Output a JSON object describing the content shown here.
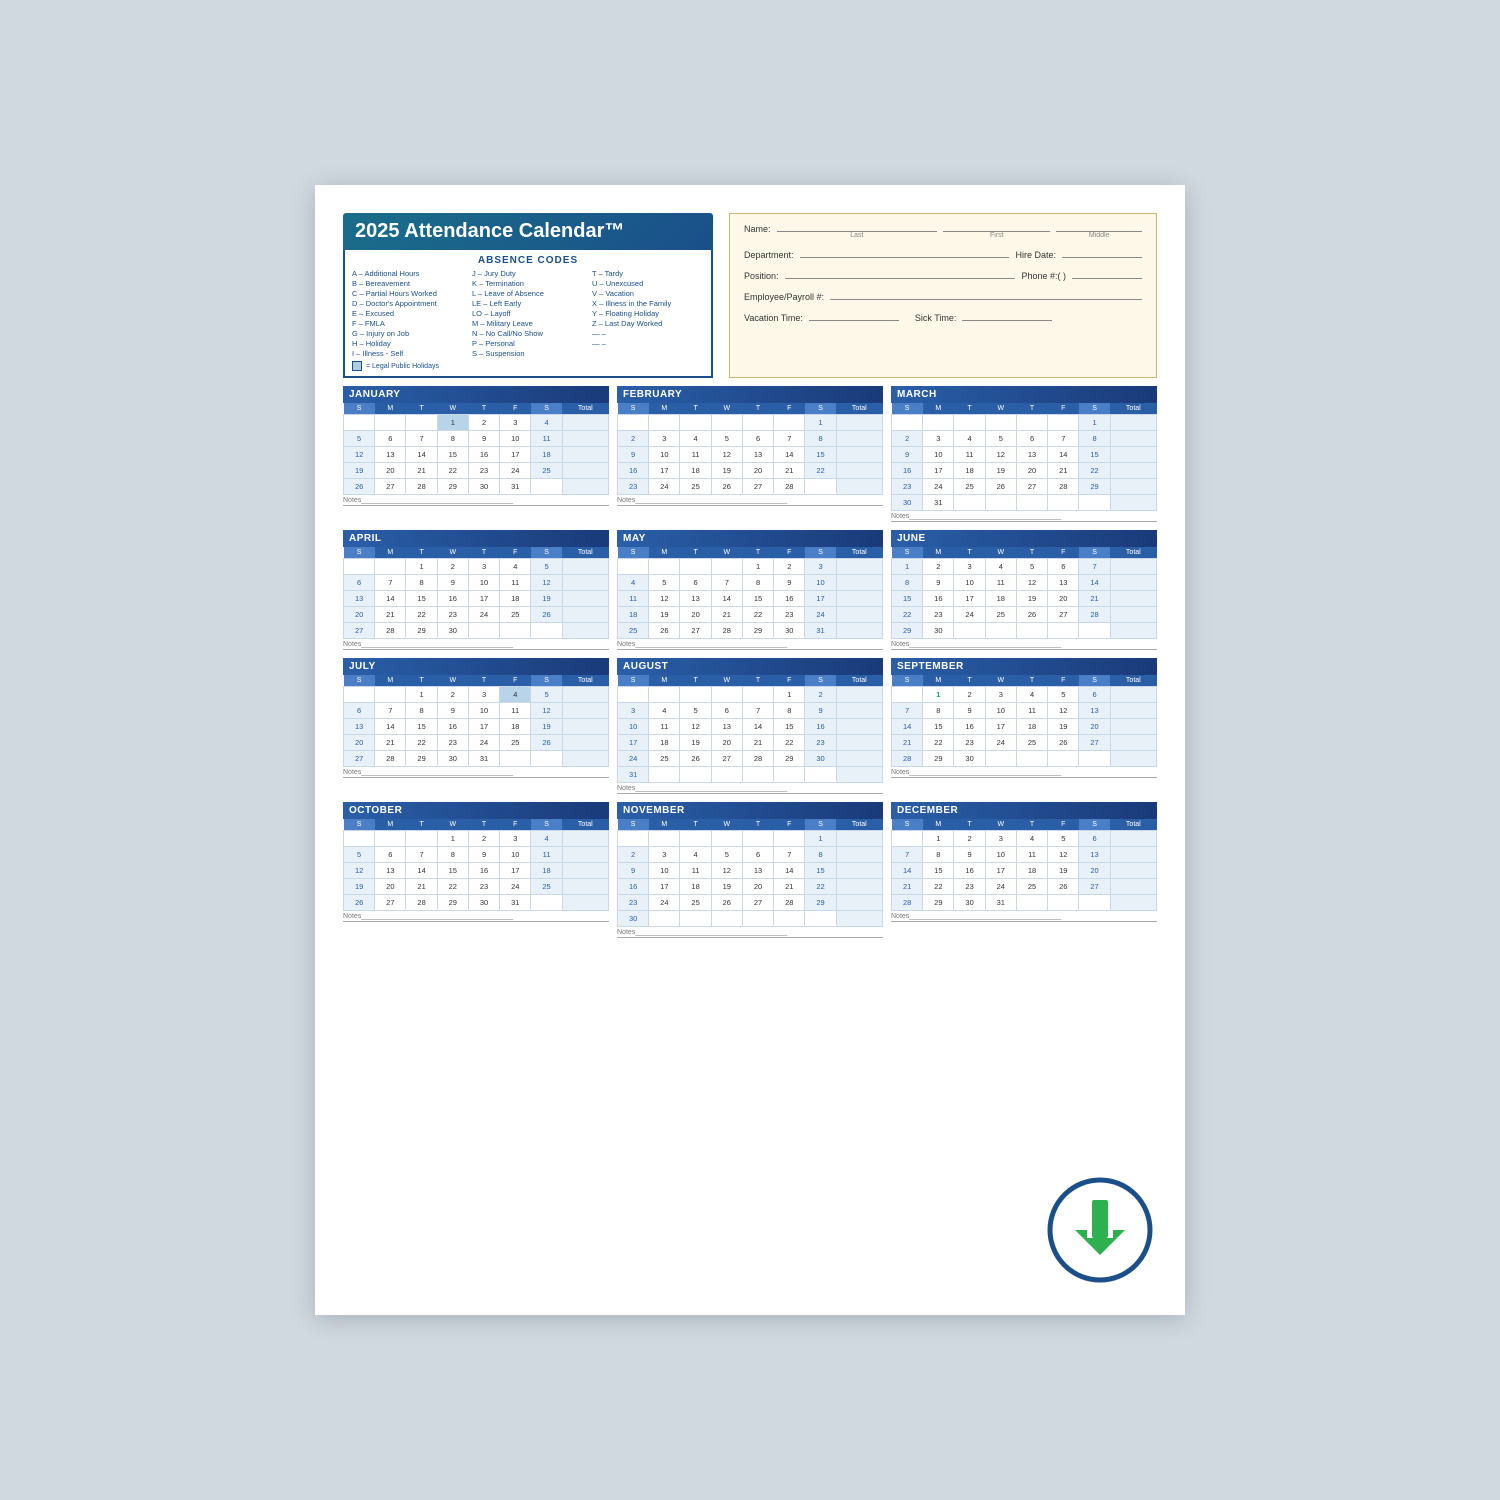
{
  "title": "2025 Attendance Calendar™",
  "absence_codes_title": "ABSENCE CODES",
  "codes_col1": [
    "A – Additional Hours",
    "B – Bereavement",
    "C – Partial Hours Worked",
    "D – Doctor's Appointment",
    "E – Excused",
    "F – FMLA",
    "G – Injury on Job",
    "H – Holiday",
    "I  – Illness - Self"
  ],
  "codes_col2": [
    "J  – Jury Duty",
    "K – Termination",
    "L  – Leave of Absence",
    "LE – Left Early",
    "LO – Layoff",
    "M – Military Leave",
    "N – No Call/No Show",
    "P  – Personal",
    "S  – Suspension"
  ],
  "codes_col3": [
    "T – Tardy",
    "U – Unexcused",
    "V – Vacation",
    "X – Illness in the Family",
    "Y – Floating Holiday",
    "Z – Last Day Worked",
    "— –",
    "— –"
  ],
  "legal_holiday_note": "= Legal Public Holidays",
  "fields": {
    "name_label": "Name:",
    "last_label": "Last",
    "first_label": "First",
    "middle_label": "Middle",
    "dept_label": "Department:",
    "hire_label": "Hire Date:",
    "hire_placeholder": "  /  /  ",
    "position_label": "Position:",
    "phone_label": "Phone #:(   )",
    "emp_label": "Employee/Payroll #:",
    "vacation_label": "Vacation Time:",
    "sick_label": "Sick Time:"
  },
  "months": [
    {
      "name": "JANUARY",
      "days_header": [
        "S",
        "M",
        "T",
        "W",
        "T",
        "F",
        "S",
        "Total"
      ],
      "weeks": [
        [
          "",
          "",
          "",
          "1",
          "2",
          "3",
          "4",
          ""
        ],
        [
          "5",
          "6",
          "7",
          "8",
          "9",
          "10",
          "11",
          ""
        ],
        [
          "12",
          "13",
          "14",
          "15",
          "16",
          "17",
          "18",
          ""
        ],
        [
          "19",
          "20",
          "21",
          "22",
          "23",
          "24",
          "25",
          ""
        ],
        [
          "26",
          "27",
          "28",
          "29",
          "30",
          "31",
          "",
          ""
        ]
      ],
      "highlighted": [
        [
          "4,1",
          "1"
        ]
      ],
      "holidays": [
        "1"
      ]
    },
    {
      "name": "FEBRUARY",
      "days_header": [
        "S",
        "M",
        "T",
        "W",
        "T",
        "F",
        "S",
        "Total"
      ],
      "weeks": [
        [
          "",
          "",
          "",
          "",
          "",
          "",
          "1",
          ""
        ],
        [
          "2",
          "3",
          "4",
          "5",
          "6",
          "7",
          "8",
          ""
        ],
        [
          "9",
          "10",
          "11",
          "12",
          "13",
          "14",
          "15",
          ""
        ],
        [
          "16",
          "17",
          "18",
          "19",
          "20",
          "21",
          "22",
          ""
        ],
        [
          "23",
          "24",
          "25",
          "26",
          "27",
          "28",
          "",
          ""
        ]
      ],
      "highlighted": [
        [
          "4,1",
          "17"
        ]
      ]
    },
    {
      "name": "MARCH",
      "days_header": [
        "S",
        "M",
        "T",
        "W",
        "T",
        "F",
        "S",
        "Total"
      ],
      "weeks": [
        [
          "",
          "",
          "",
          "",
          "",
          "",
          "1",
          ""
        ],
        [
          "2",
          "3",
          "4",
          "5",
          "6",
          "7",
          "8",
          ""
        ],
        [
          "9",
          "10",
          "11",
          "12",
          "13",
          "14",
          "15",
          ""
        ],
        [
          "16",
          "17",
          "18",
          "19",
          "20",
          "21",
          "22",
          ""
        ],
        [
          "23",
          "24",
          "25",
          "26",
          "27",
          "28",
          "29",
          ""
        ],
        [
          "30",
          "31",
          "",
          "",
          "",
          "",
          "",
          ""
        ]
      ]
    },
    {
      "name": "APRIL",
      "days_header": [
        "S",
        "M",
        "T",
        "W",
        "T",
        "F",
        "S",
        "Total"
      ],
      "weeks": [
        [
          "",
          "",
          "1",
          "2",
          "3",
          "4",
          "5",
          ""
        ],
        [
          "6",
          "7",
          "8",
          "9",
          "10",
          "11",
          "12",
          ""
        ],
        [
          "13",
          "14",
          "15",
          "16",
          "17",
          "18",
          "19",
          ""
        ],
        [
          "20",
          "21",
          "22",
          "23",
          "24",
          "25",
          "26",
          ""
        ],
        [
          "27",
          "28",
          "29",
          "30",
          "",
          "",
          "",
          ""
        ]
      ]
    },
    {
      "name": "MAY",
      "days_header": [
        "S",
        "M",
        "T",
        "W",
        "T",
        "F",
        "S",
        "Total"
      ],
      "weeks": [
        [
          "",
          "",
          "",
          "",
          "1",
          "2",
          "3",
          ""
        ],
        [
          "4",
          "5",
          "6",
          "7",
          "8",
          "9",
          "10",
          ""
        ],
        [
          "11",
          "12",
          "13",
          "14",
          "15",
          "16",
          "17",
          ""
        ],
        [
          "18",
          "19",
          "20",
          "21",
          "22",
          "23",
          "24",
          ""
        ],
        [
          "25",
          "26",
          "27",
          "28",
          "29",
          "30",
          "31",
          ""
        ]
      ],
      "highlighted": [
        [
          "5,2",
          "26"
        ]
      ]
    },
    {
      "name": "JUNE",
      "days_header": [
        "S",
        "M",
        "T",
        "W",
        "T",
        "F",
        "S",
        "Total"
      ],
      "weeks": [
        [
          "1",
          "2",
          "3",
          "4",
          "5",
          "6",
          "7",
          ""
        ],
        [
          "8",
          "9",
          "10",
          "11",
          "12",
          "13",
          "14",
          ""
        ],
        [
          "15",
          "16",
          "17",
          "18",
          "19",
          "20",
          "21",
          ""
        ],
        [
          "22",
          "23",
          "24",
          "25",
          "26",
          "27",
          "28",
          ""
        ],
        [
          "29",
          "30",
          "",
          "",
          "",
          "",
          "",
          ""
        ]
      ],
      "highlighted": [
        [
          "3,5",
          "19"
        ]
      ]
    },
    {
      "name": "JULY",
      "days_header": [
        "S",
        "M",
        "T",
        "W",
        "T",
        "F",
        "S",
        "Total"
      ],
      "weeks": [
        [
          "",
          "",
          "1",
          "2",
          "3",
          "4",
          "5",
          ""
        ],
        [
          "6",
          "7",
          "8",
          "9",
          "10",
          "11",
          "12",
          ""
        ],
        [
          "13",
          "14",
          "15",
          "16",
          "17",
          "18",
          "19",
          ""
        ],
        [
          "20",
          "21",
          "22",
          "23",
          "24",
          "25",
          "26",
          ""
        ],
        [
          "27",
          "28",
          "29",
          "30",
          "31",
          "",
          "",
          ""
        ]
      ],
      "highlighted": [
        [
          "1,5",
          "4"
        ]
      ],
      "holidays": [
        "4"
      ]
    },
    {
      "name": "AUGUST",
      "days_header": [
        "S",
        "M",
        "T",
        "W",
        "T",
        "F",
        "S",
        "Total"
      ],
      "weeks": [
        [
          "",
          "",
          "",
          "",
          "",
          "1",
          "2",
          ""
        ],
        [
          "3",
          "4",
          "5",
          "6",
          "7",
          "8",
          "9",
          ""
        ],
        [
          "10",
          "11",
          "12",
          "13",
          "14",
          "15",
          "16",
          ""
        ],
        [
          "17",
          "18",
          "19",
          "20",
          "21",
          "22",
          "23",
          ""
        ],
        [
          "24",
          "25",
          "26",
          "27",
          "28",
          "29",
          "30",
          ""
        ],
        [
          "31",
          "",
          "",
          "",
          "",
          "",
          "",
          ""
        ]
      ]
    },
    {
      "name": "SEPTEMBER",
      "days_header": [
        "S",
        "M",
        "T",
        "W",
        "T",
        "F",
        "S",
        "Total"
      ],
      "weeks": [
        [
          "",
          "1",
          "2",
          "3",
          "4",
          "5",
          "6",
          ""
        ],
        [
          "7",
          "8",
          "9",
          "10",
          "11",
          "12",
          "13",
          ""
        ],
        [
          "14",
          "15",
          "16",
          "17",
          "18",
          "19",
          "20",
          ""
        ],
        [
          "21",
          "22",
          "23",
          "24",
          "25",
          "26",
          "27",
          ""
        ],
        [
          "28",
          "29",
          "30",
          "",
          "",
          "",
          "",
          ""
        ]
      ],
      "highlighted": [
        [
          "1,2",
          "1"
        ]
      ]
    },
    {
      "name": "OCTOBER",
      "days_header": [
        "S",
        "M",
        "T",
        "W",
        "T",
        "F",
        "S",
        "Total"
      ],
      "weeks": [
        [
          "",
          "",
          "",
          "1",
          "2",
          "3",
          "4",
          ""
        ],
        [
          "5",
          "6",
          "7",
          "8",
          "9",
          "10",
          "11",
          ""
        ],
        [
          "12",
          "13",
          "14",
          "15",
          "16",
          "17",
          "18",
          ""
        ],
        [
          "19",
          "20",
          "21",
          "22",
          "23",
          "24",
          "25",
          ""
        ],
        [
          "26",
          "27",
          "28",
          "29",
          "30",
          "31",
          "",
          ""
        ]
      ],
      "highlighted": [
        [
          "3,2",
          "13"
        ]
      ]
    },
    {
      "name": "NOVEMBER",
      "days_header": [
        "S",
        "M",
        "T",
        "W",
        "T",
        "F",
        "S",
        "Total"
      ],
      "weeks": [
        [
          "",
          "",
          "",
          "",
          "",
          "",
          "1",
          ""
        ],
        [
          "2",
          "3",
          "4",
          "5",
          "6",
          "7",
          "8",
          ""
        ],
        [
          "9",
          "10",
          "11",
          "12",
          "13",
          "14",
          "15",
          ""
        ],
        [
          "16",
          "17",
          "18",
          "19",
          "20",
          "21",
          "22",
          ""
        ],
        [
          "23",
          "24",
          "25",
          "26",
          "27",
          "28",
          "29",
          ""
        ],
        [
          "30",
          "",
          "",
          "",
          "",
          "",
          "",
          ""
        ]
      ],
      "highlighted": [
        [
          "3,2",
          "11"
        ],
        [
          "5,5",
          "27"
        ]
      ]
    },
    {
      "name": "DECEMBER",
      "days_header": [
        "S",
        "M",
        "T",
        "W",
        "T",
        "F",
        "S",
        "Total"
      ],
      "weeks": [
        [
          "",
          "1",
          "2",
          "3",
          "4",
          "5",
          "6",
          ""
        ],
        [
          "7",
          "8",
          "9",
          "10",
          "11",
          "12",
          "13",
          ""
        ],
        [
          "14",
          "15",
          "16",
          "17",
          "18",
          "19",
          "20",
          ""
        ],
        [
          "21",
          "22",
          "23",
          "24",
          "25",
          "26",
          "27",
          ""
        ],
        [
          "28",
          "29",
          "30",
          "31",
          "",
          "",
          "",
          ""
        ]
      ]
    }
  ],
  "notes_label": "Notes",
  "download_icon_color": "#1a4f8a",
  "download_arrow_color": "#2cb050"
}
